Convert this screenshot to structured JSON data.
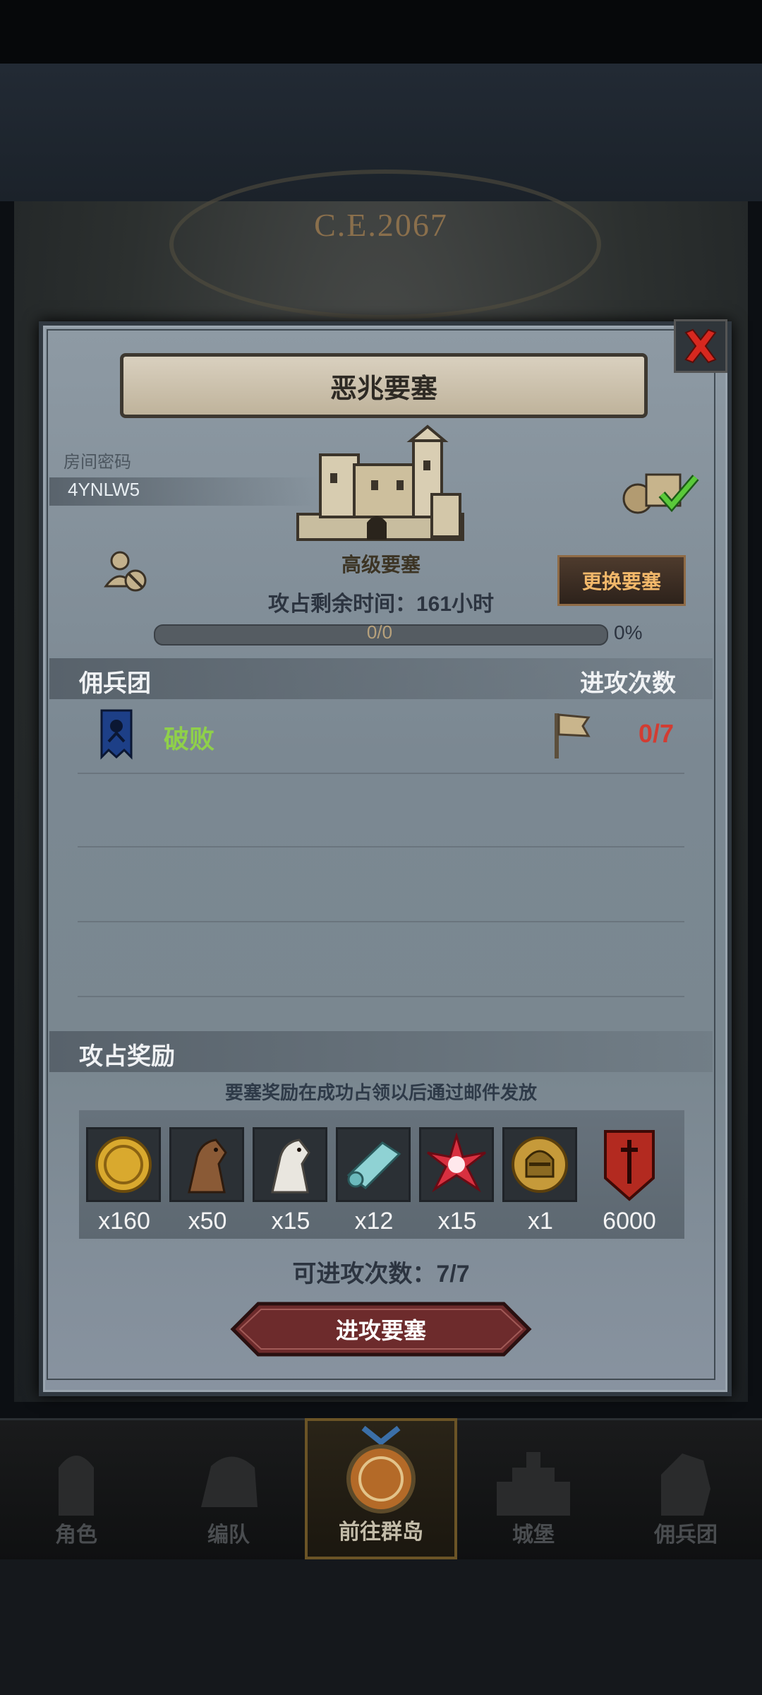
{
  "header": {
    "year": "C.E.2067"
  },
  "dialog": {
    "title": "恶兆要塞",
    "room_password_label": "房间密码",
    "room_password": "4YNLW5",
    "fortress_level": "高级要塞",
    "change_button": "更换要塞",
    "time_remaining": "攻占剩余时间：161小时",
    "progress_text": "0/0",
    "progress_value": 0,
    "progress_percent": "0%",
    "mercenary_header": "佣兵团",
    "attack_count_header": "进攻次数",
    "rows": [
      {
        "status": "破败",
        "count": "0/7"
      }
    ],
    "reward_header": "攻占奖励",
    "reward_note": "要塞奖励在成功占领以后通过邮件发放",
    "rewards": [
      {
        "icon": "gold-coin-icon",
        "qty": "x160"
      },
      {
        "icon": "brown-horse-icon",
        "qty": "x50"
      },
      {
        "icon": "white-horse-icon",
        "qty": "x15"
      },
      {
        "icon": "cloth-scroll-icon",
        "qty": "x12"
      },
      {
        "icon": "red-star-icon",
        "qty": "x15"
      },
      {
        "icon": "knight-helmet-icon",
        "qty": "x1"
      },
      {
        "icon": "red-banner-icon",
        "qty": "6000"
      }
    ],
    "attacks_available": "可进攻次数：7/7",
    "attack_button": "进攻要塞"
  },
  "nav": {
    "items": [
      {
        "label": "角色"
      },
      {
        "label": "编队"
      },
      {
        "label": "前往群岛"
      },
      {
        "label": "城堡"
      },
      {
        "label": "佣兵团"
      }
    ],
    "active_index": 2
  },
  "colors": {
    "status_green": "#8fd04a",
    "count_red": "#d23c32",
    "button_gold": "#f2b86a",
    "attack_button_red": "#6d2b2c"
  }
}
